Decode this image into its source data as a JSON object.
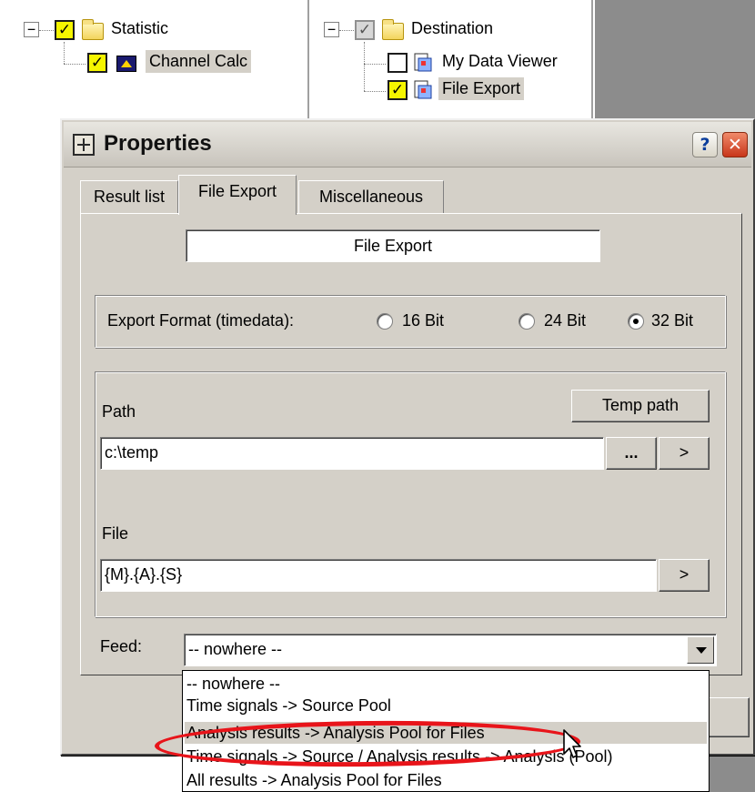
{
  "tree_left": {
    "root": {
      "label": "Statistic",
      "checked": true
    },
    "children": [
      {
        "label": "Channel Calc",
        "checked": true
      }
    ]
  },
  "tree_mid": {
    "root": {
      "label": "Destination",
      "checked": "partial"
    },
    "children": [
      {
        "label": "My Data Viewer",
        "checked": false
      },
      {
        "label": "File Export",
        "checked": true
      }
    ]
  },
  "dialog": {
    "title": "Properties",
    "help_label": "?",
    "close_label": "✕"
  },
  "tabs": [
    {
      "label": "Result list",
      "active": false
    },
    {
      "label": "File Export",
      "active": true
    },
    {
      "label": "Miscellaneous",
      "active": false
    }
  ],
  "file_export": {
    "name_value": "File Export",
    "format": {
      "label": "Export Format (timedata):",
      "options": [
        "16 Bit",
        "24 Bit",
        "32 Bit"
      ],
      "selected": "32 Bit"
    },
    "path": {
      "label": "Path",
      "temp_button": "Temp path",
      "value": "c:\\temp",
      "browse_button": "...",
      "arrow_button": ">"
    },
    "file": {
      "label": "File",
      "value": "{M}.{A}.{S}",
      "arrow_button": ">"
    },
    "feed": {
      "label": "Feed:",
      "selected": "-- nowhere --",
      "options": [
        "-- nowhere --",
        "Time signals -> Source Pool",
        "Analysis results -> Analysis Pool for Files",
        "Time signals -> Source / Analysis results -> Analysis (Pool)",
        "All results -> Analysis Pool for Files"
      ],
      "highlighted_index": 2
    }
  },
  "colors": {
    "dialog_bg": "#d4d0c8",
    "highlight_ellipse": "#e8141a",
    "checkbox_checked": "#f5f500",
    "close_button": "#c8361a"
  }
}
